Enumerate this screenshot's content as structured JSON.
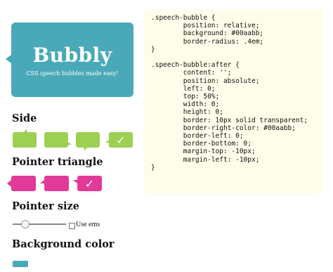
{
  "preview": {
    "title": "Bubbly",
    "subtitle": "CSS speech bubbles made easy!",
    "color": "#4aa9b8"
  },
  "side": {
    "heading": "Side",
    "options": [
      "top",
      "right",
      "bottom",
      "left"
    ],
    "selected": "left",
    "selected_mark": "✓",
    "color": "#9ccf52"
  },
  "pointer_triangle": {
    "heading": "Pointer triangle",
    "selected_mark": "✓",
    "color": "#e23a98"
  },
  "pointer_size": {
    "heading": "Pointer size",
    "slider_value_fraction": 0.2,
    "use_ems_label": "Use ems",
    "use_ems_checked": false
  },
  "background_color": {
    "heading": "Background color",
    "value": "#4aa9b8"
  },
  "code": {
    "lines": [
      ".speech-bubble {",
      "        position: relative;",
      "        background: #00aabb;",
      "        border-radius: .4em;",
      "}",
      "",
      ".speech-bubble:after {",
      "        content: '';",
      "        position: absolute;",
      "        left: 0;",
      "        top: 50%;",
      "        width: 0;",
      "        height: 0;",
      "        border: 10px solid transparent;",
      "        border-right-color: #00aabb;",
      "        border-left: 0;",
      "        border-bottom: 0;",
      "        margin-top: -10px;",
      "        margin-left: -10px;",
      "}"
    ]
  }
}
